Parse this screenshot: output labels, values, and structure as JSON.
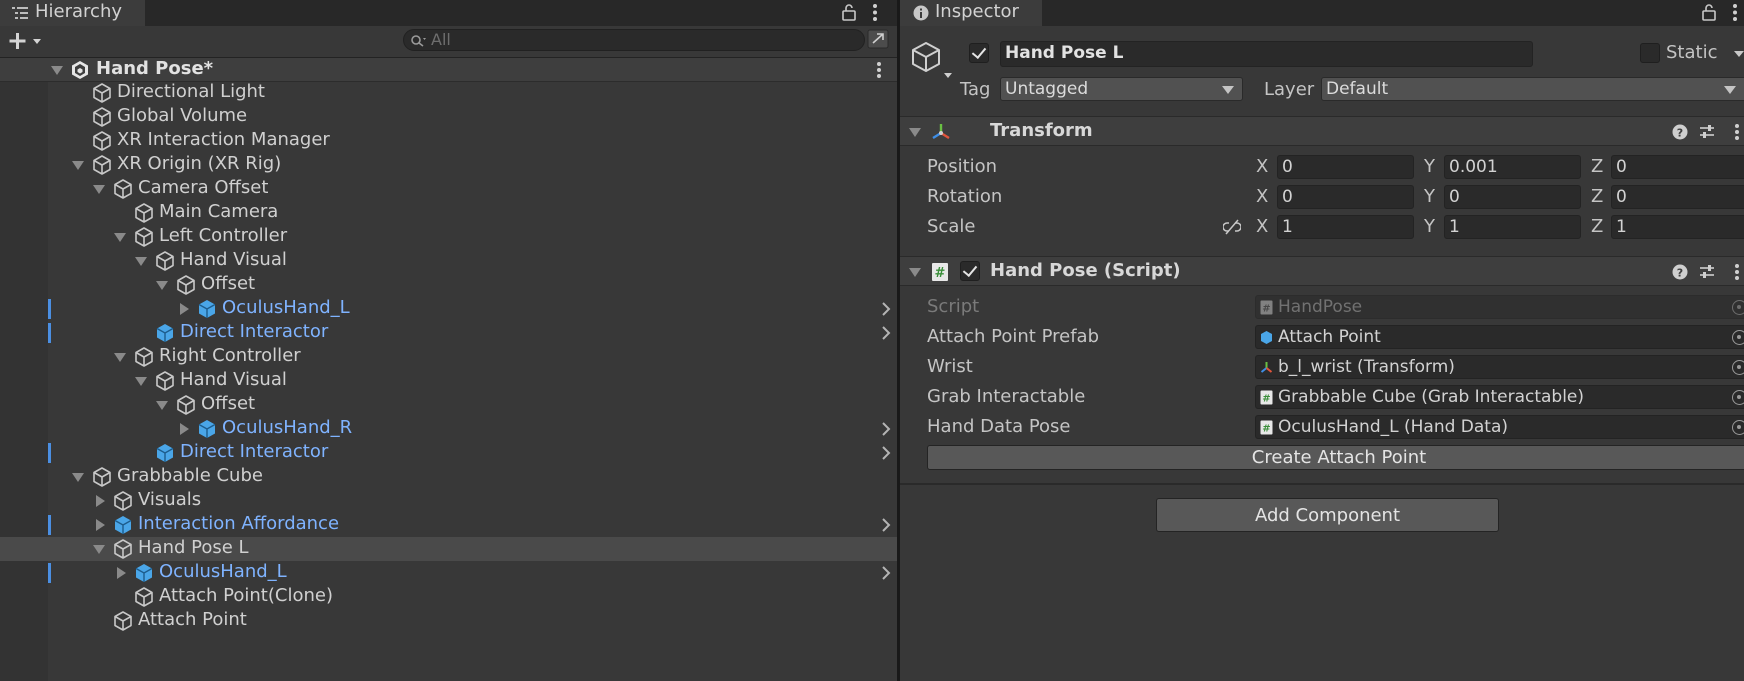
{
  "hierarchy": {
    "tab_title": "Hierarchy",
    "search_placeholder": "All",
    "scene_name": "Hand Pose*",
    "items": [
      {
        "label": "Directional Light"
      },
      {
        "label": "Global Volume"
      },
      {
        "label": "XR Interaction Manager"
      },
      {
        "label": "XR Origin (XR Rig)"
      },
      {
        "label": "Camera Offset"
      },
      {
        "label": "Main Camera"
      },
      {
        "label": "Left Controller"
      },
      {
        "label": "Hand Visual"
      },
      {
        "label": "Offset"
      },
      {
        "label": "OculusHand_L"
      },
      {
        "label": "Direct Interactor"
      },
      {
        "label": "Right Controller"
      },
      {
        "label": "Hand Visual"
      },
      {
        "label": "Offset"
      },
      {
        "label": "OculusHand_R"
      },
      {
        "label": "Direct Interactor"
      },
      {
        "label": "Grabbable Cube"
      },
      {
        "label": "Visuals"
      },
      {
        "label": "Interaction Affordance"
      },
      {
        "label": "Hand Pose L"
      },
      {
        "label": "OculusHand_L"
      },
      {
        "label": "Attach Point(Clone)"
      },
      {
        "label": "Attach Point"
      }
    ]
  },
  "inspector": {
    "tab_title": "Inspector",
    "object_name": "Hand Pose L",
    "static_label": "Static",
    "tag_label": "Tag",
    "tag_value": "Untagged",
    "layer_label": "Layer",
    "layer_value": "Default",
    "transform": {
      "title": "Transform",
      "position_label": "Position",
      "rotation_label": "Rotation",
      "scale_label": "Scale",
      "x_label": "X",
      "y_label": "Y",
      "z_label": "Z",
      "position": {
        "x": "0",
        "y": "0.001",
        "z": "0"
      },
      "rotation": {
        "x": "0",
        "y": "0",
        "z": "0"
      },
      "scale": {
        "x": "1",
        "y": "1",
        "z": "1"
      }
    },
    "hand_pose_script": {
      "title": "Hand Pose (Script)",
      "script_label": "Script",
      "script_value": "HandPose",
      "attach_point_prefab_label": "Attach Point Prefab",
      "attach_point_prefab_value": "Attach Point",
      "wrist_label": "Wrist",
      "wrist_value": "b_l_wrist (Transform)",
      "grab_interactable_label": "Grab Interactable",
      "grab_interactable_value": "Grabbable Cube (Grab Interactable)",
      "hand_data_pose_label": "Hand Data Pose",
      "hand_data_pose_value": "OculusHand_L (Hand Data)",
      "create_attach_point_label": "Create Attach Point"
    },
    "add_component_label": "Add Component"
  },
  "colors": {
    "prefab_blue": "#7fb3ff",
    "background": "#383838",
    "selection": "#4a4a4a"
  }
}
